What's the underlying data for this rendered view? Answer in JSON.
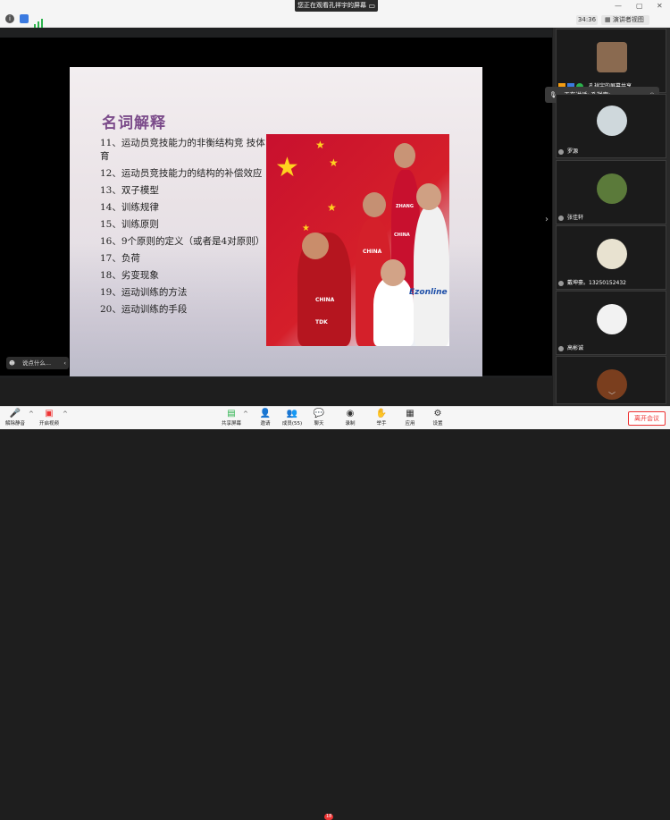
{
  "banner": {
    "text": "您正在观看孔祥宇的屏幕",
    "icon": "screen-share-icon"
  },
  "topbar": {
    "timer": "34:36",
    "view_label": "演讲者视图"
  },
  "slide": {
    "title": "名词解释",
    "items": [
      "11、运动员竞技能力的非衡结构竞 技体育",
      "12、运动员竞技能力的结构的补偿效应",
      "13、双子模型",
      "14、训练规律",
      "15、训练原则",
      "16、9个原则的定义（或者是4对原则）",
      "17、负荷",
      "18、劣变现象",
      "19、运动训练的方法",
      "20、运动训练的手段"
    ],
    "photo_text": [
      "CHINA",
      "ZHANG",
      "CHINA",
      "CHINA",
      "Ezonline",
      "TDK"
    ]
  },
  "speaking": {
    "text": "正在讲话: 孔祥宇;"
  },
  "participants": [
    {
      "name": "孔祥宇的屏幕共享",
      "avatar_color": "#8a6a50"
    },
    {
      "name": "罗源",
      "avatar_color": "#cfd8dc"
    },
    {
      "name": "张佳轩",
      "avatar_color": "#5b7a3a"
    },
    {
      "name": "戴坤豪。13250152432",
      "avatar_color": "#e8e2d0"
    },
    {
      "name": "高彬诚",
      "avatar_color": "#f2f2f2"
    },
    {
      "name": "",
      "avatar_color": "#7a3e1e"
    }
  ],
  "chat": {
    "placeholder": "说点什么..."
  },
  "toolbar": {
    "unmute": "解除静音",
    "start_video": "开启视频",
    "share": "共享屏幕",
    "invite": "邀请",
    "members": "成员(55)",
    "chat": "聊天",
    "chat_badge": "18",
    "record": "录制",
    "raise_hand": "举手",
    "apps": "应用",
    "settings": "设置",
    "leave": "离开会议"
  },
  "colors": {
    "accent_red": "#e33333",
    "title_purple": "#7b4b8a",
    "flag_red": "#c8102e"
  }
}
